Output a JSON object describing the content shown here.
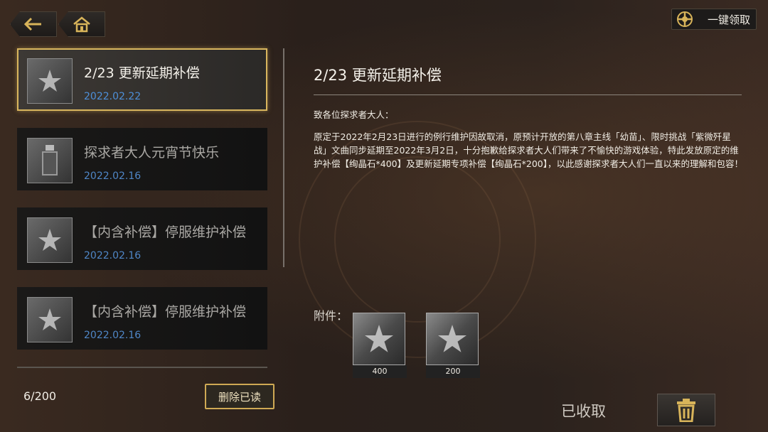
{
  "nav": {
    "back_icon": "back-arrow-icon",
    "home_icon": "home-icon"
  },
  "header": {
    "claim_all_label": "一键领取",
    "claim_all_icon": "claim-all-icon"
  },
  "mail_list": {
    "items": [
      {
        "title": "2/23 更新延期补偿",
        "date": "2022.02.22",
        "icon": "star-emblem-icon",
        "selected": true
      },
      {
        "title": "探求者大人元宵节快乐",
        "date": "2022.02.16",
        "icon": "bottle-icon",
        "selected": false
      },
      {
        "title": "【内含补偿】停服维护补偿",
        "date": "2022.02.16",
        "icon": "star-emblem-icon",
        "selected": false
      },
      {
        "title": "【内含补偿】停服维护补偿",
        "date": "2022.02.16",
        "icon": "star-emblem-icon",
        "selected": false
      }
    ],
    "count": "6/200",
    "delete_read_label": "删除已读"
  },
  "detail": {
    "title": "2/23 更新延期补偿",
    "greeting": "致各位探求者大人：",
    "body": "原定于2022年2月23日进行的例行维护因故取消，原预计开放的第八章主线「幼苗」、限时挑战「紫微歼星战」文曲同步延期至2022年3月2日，十分抱歉给探求者大人们带来了不愉快的游戏体验，特此发放原定的维护补偿【绚晶石*400】及更新延期专项补偿【绚晶石*200】，以此感谢探求者大人们一直以来的理解和包容！",
    "attachments_label": "附件：",
    "attachments": [
      {
        "quantity": "400",
        "icon": "crystal-icon"
      },
      {
        "quantity": "200",
        "icon": "crystal-icon"
      }
    ],
    "claimed_label": "已收取",
    "delete_icon": "trash-icon"
  },
  "colors": {
    "accent_gold": "#d9b65e",
    "date_blue": "#4d8fd8"
  }
}
